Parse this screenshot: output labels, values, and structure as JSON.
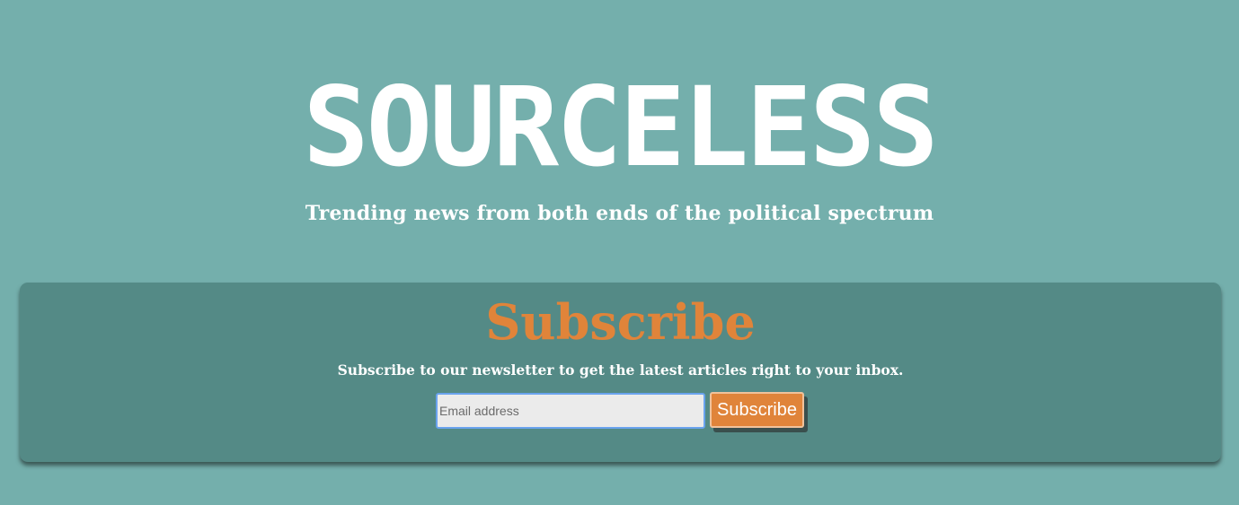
{
  "header": {
    "title": "SOURCELESS",
    "tagline": "Trending news from both ends of the political spectrum"
  },
  "subscribe": {
    "heading": "Subscribe",
    "description": "Subscribe to our newsletter to get the latest articles right to your inbox.",
    "email_placeholder": "Email address",
    "email_value": "",
    "button_label": "Subscribe"
  },
  "colors": {
    "background": "#74afac",
    "panel": "#548a86",
    "accent": "#e0843a",
    "text": "#ffffff"
  }
}
